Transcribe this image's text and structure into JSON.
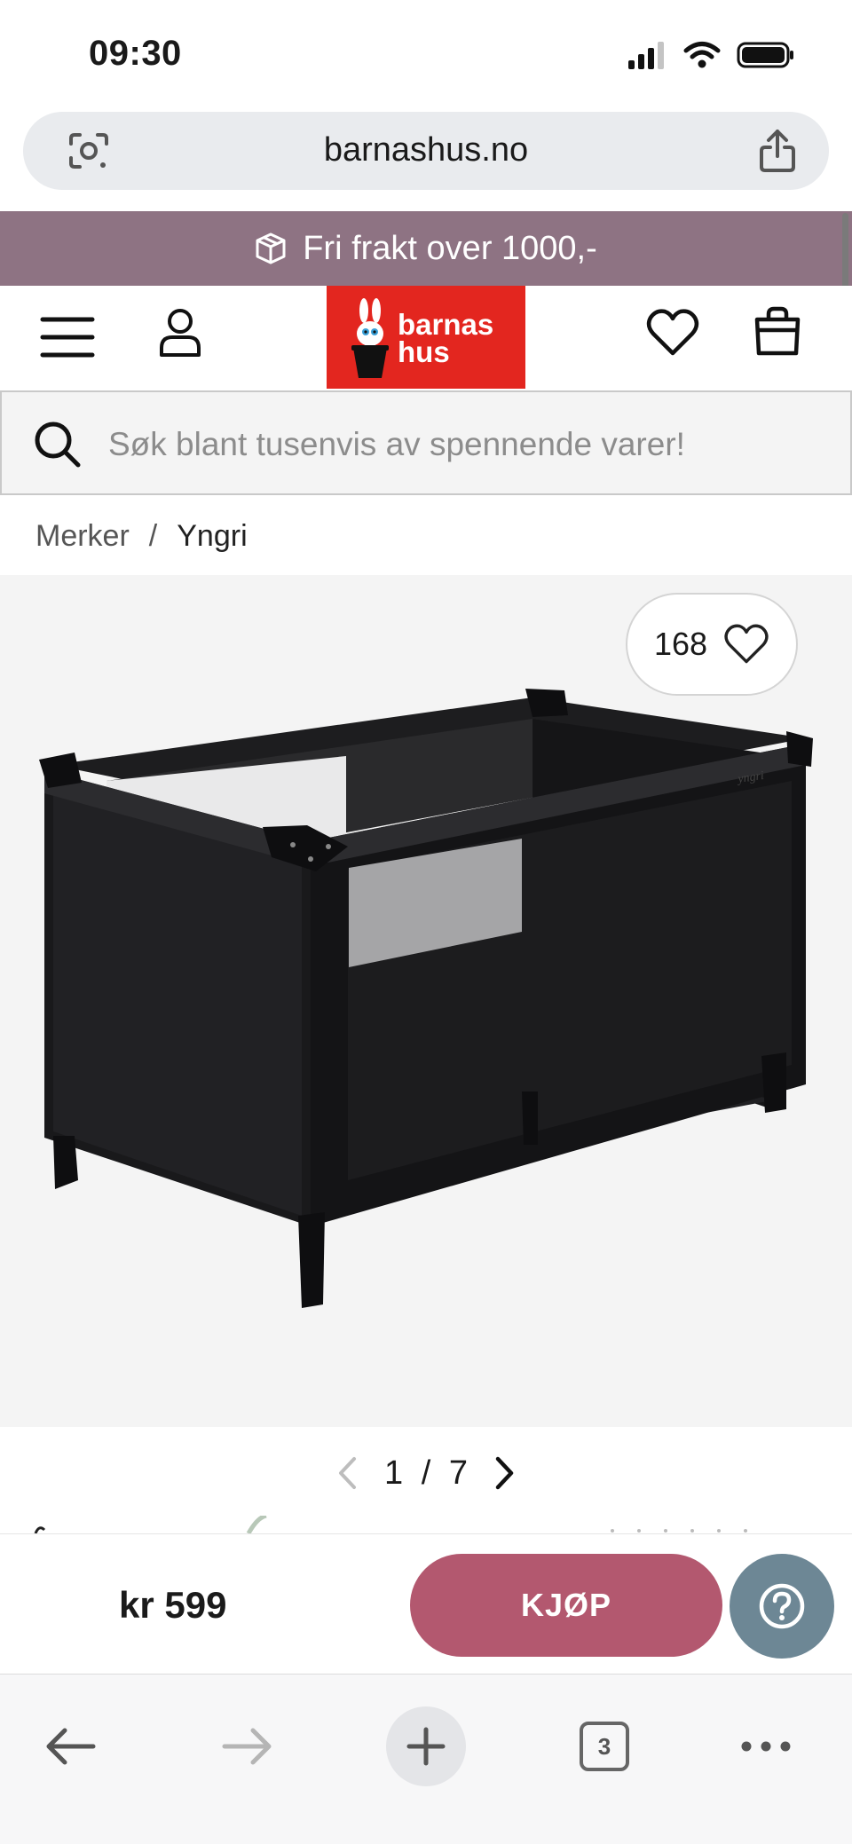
{
  "status_bar": {
    "time": "09:30"
  },
  "url_bar": {
    "url": "barnashus.no"
  },
  "promo": {
    "text": "Fri frakt over 1000,-"
  },
  "header": {
    "logo_line1": "barnas",
    "logo_line2": "hus"
  },
  "search": {
    "placeholder": "Søk blant tusenvis av spennende varer!"
  },
  "breadcrumb": {
    "items": [
      "Merker",
      "Yngri"
    ],
    "separator": "/"
  },
  "product": {
    "likes": "168",
    "image_index": "1",
    "image_total": "7",
    "pager_separator": "/"
  },
  "buy_bar": {
    "price": "kr 599",
    "buy_label": "KJØP"
  },
  "browser_nav": {
    "tab_count": "3"
  },
  "colors": {
    "promo_bg": "#8e7383",
    "logo_bg": "#e3261f",
    "buy_button": "#b3586f",
    "help_button": "#6d8795"
  },
  "icons": [
    "camera-lens-icon",
    "share-icon",
    "package-icon",
    "menu-icon",
    "user-icon",
    "heart-icon",
    "shopping-bag-icon",
    "search-icon",
    "chevron-left-icon",
    "chevron-right-icon",
    "question-icon",
    "back-arrow-icon",
    "forward-arrow-icon",
    "plus-icon",
    "tabs-icon",
    "more-icon"
  ]
}
